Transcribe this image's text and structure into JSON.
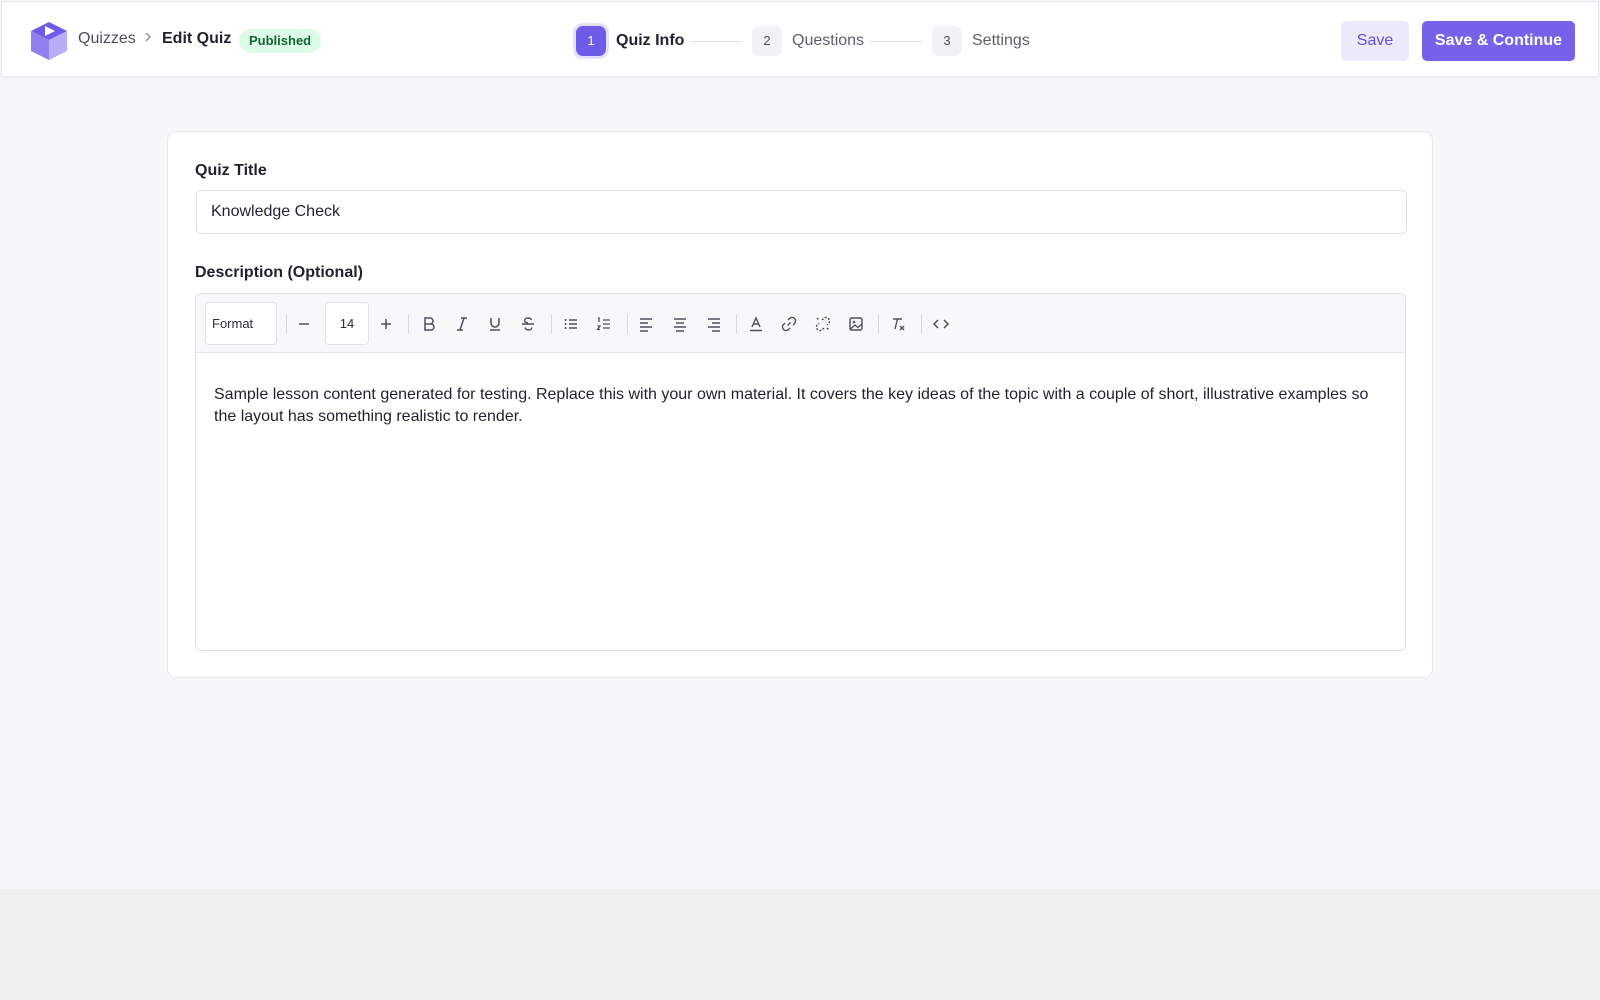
{
  "header": {
    "breadcrumb_root": "Quizzes",
    "breadcrumb_current": "Edit Quiz",
    "status_badge": "Published",
    "save_label": "Save",
    "save_continue_label": "Save & Continue"
  },
  "stepper": {
    "steps": [
      {
        "number": "1",
        "label": "Quiz Info",
        "active": true
      },
      {
        "number": "2",
        "label": "Questions",
        "active": false
      },
      {
        "number": "3",
        "label": "Settings",
        "active": false
      }
    ]
  },
  "form": {
    "title_label": "Quiz Title",
    "title_value": "Knowledge Check",
    "description_label": "Description (Optional)"
  },
  "editor": {
    "format_label": "Format",
    "font_size": "14",
    "content": "Sample lesson content generated for testing. Replace this with your own material. It covers the key ideas of the topic with a couple of short, illustrative examples so the layout has something realistic to render."
  },
  "colors": {
    "accent": "#7562e8",
    "badge_bg": "#dcfce7",
    "badge_text": "#166534"
  }
}
